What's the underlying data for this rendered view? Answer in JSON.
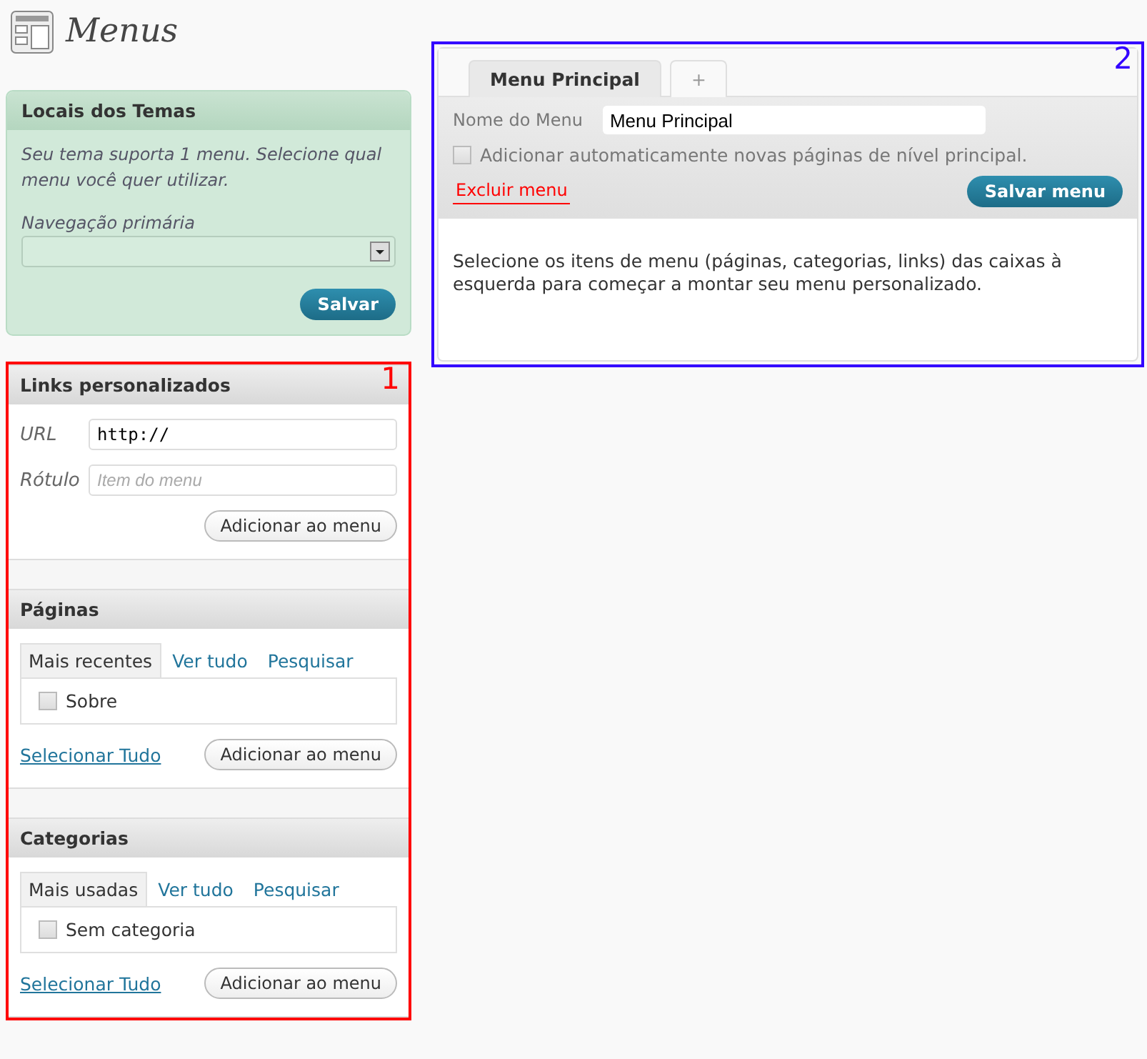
{
  "page_title": "Menus",
  "theme_locations": {
    "title": "Locais dos Temas",
    "description": "Seu tema suporta 1 menu. Selecione qual menu você quer utilizar.",
    "select_label": "Navegação primária",
    "button": "Salvar"
  },
  "custom_links": {
    "title": "Links personalizados",
    "fields": [
      {
        "label": "URL",
        "value": "http://"
      },
      {
        "label": "Rótulo",
        "placeholder": "Item do menu"
      }
    ],
    "button": "Adicionar ao menu"
  },
  "boxes": [
    {
      "title": "Páginas",
      "tabs": [
        {
          "label": "Mais recentes",
          "selected": true
        },
        {
          "label": "Ver tudo",
          "selected": false
        },
        {
          "label": "Pesquisar",
          "selected": false
        }
      ],
      "items": [
        {
          "label": "Sobre",
          "checked": false
        }
      ],
      "select_all": "Selecionar Tudo",
      "button": "Adicionar ao menu"
    },
    {
      "title": "Categorias",
      "tabs": [
        {
          "label": "Mais usadas",
          "selected": true
        },
        {
          "label": "Ver tudo",
          "selected": false
        },
        {
          "label": "Pesquisar",
          "selected": false
        }
      ],
      "items": [
        {
          "label": "Sem categoria",
          "checked": false
        }
      ],
      "select_all": "Selecionar Tudo",
      "button": "Adicionar ao menu"
    }
  ],
  "menu_editor": {
    "tabs": [
      {
        "label": "Menu Principal",
        "selected": true
      },
      {
        "label": "+",
        "selected": false
      }
    ],
    "name_label": "Nome do Menu",
    "name_value": "Menu Principal",
    "auto_add": {
      "label": "Adicionar automaticamente novas páginas de nível principal.",
      "checked": false
    },
    "delete_link": "Excluir menu",
    "save_button": "Salvar menu",
    "instructions": "Selecione os itens de menu (páginas, categorias, links) das caixas à esquerda para começar a montar seu menu personalizado."
  },
  "annotations": [
    {
      "label": "1",
      "color": "#ff0000"
    },
    {
      "label": "2",
      "color": "#3300ff"
    }
  ]
}
